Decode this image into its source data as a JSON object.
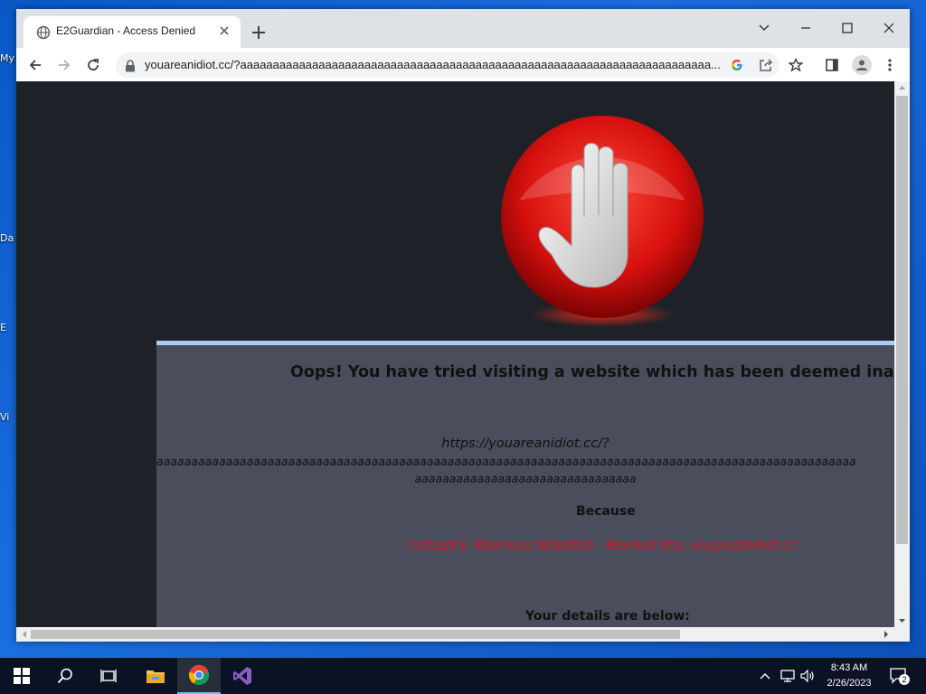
{
  "desktop": {
    "icon_labels": [
      "My",
      "Da",
      "E",
      "Vi"
    ]
  },
  "browser": {
    "tab_title": "E2Guardian - Access Denied",
    "url": "youareanidiot.cc/?aaaaaaaaaaaaaaaaaaaaaaaaaaaaaaaaaaaaaaaaaaaaaaaaaaaaaaaaaaaaaaaaaaaaaaaa..."
  },
  "page": {
    "headline": "Oops! You have tried visiting a website which has been deemed inappropriat",
    "blocked_url_line1": "https://youareanidiot.cc/?",
    "blocked_url_line2": "aaaaaaaaaaaaaaaaaaaaaaaaaaaaaaaaaaaaaaaaaaaaaaaaaaaaaaaaaaaaaaaaaaaaaaaaaaaaaaaaaaaaaaaaaaaaaaaaaaaaa",
    "blocked_url_line3": "aaaaaaaaaaaaaaaaaaaaaaaaaaaaaaaa",
    "because": "Because",
    "category": "Category: Malicious Websites - Blocked site: youareanidiot.cc",
    "details": "Your details are below:"
  },
  "taskbar": {
    "time": "8:43 AM",
    "date": "2/26/2023",
    "notification_count": "2"
  },
  "colors": {
    "page_bg": "#1e2128",
    "panel_bg": "#4a4e5c",
    "category_text": "#e4111c",
    "panel_border": "#a9cdf0"
  },
  "icons": [
    "globe-icon",
    "close-icon",
    "plus-icon",
    "minimize-icon",
    "maximize-icon",
    "chevron-down-icon",
    "back-icon",
    "forward-icon",
    "reload-icon",
    "lock-icon",
    "google-icon",
    "share-icon",
    "star-icon",
    "sidepanel-icon",
    "profile-icon",
    "menu-icon",
    "stop-hand-icon",
    "windows-start-icon",
    "search-icon",
    "taskview-icon",
    "file-explorer-icon",
    "chrome-icon",
    "visual-studio-icon",
    "chevron-up-icon",
    "network-icon",
    "volume-icon",
    "notification-icon"
  ]
}
